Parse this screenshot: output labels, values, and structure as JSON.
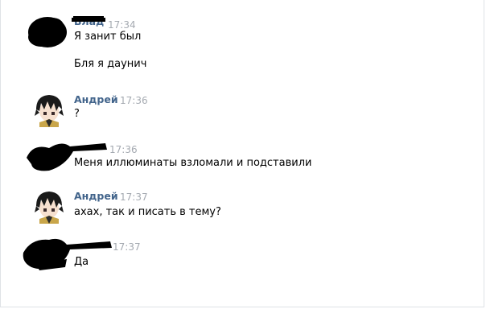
{
  "messages": [
    {
      "author": "Влад",
      "time": "17:34",
      "lines": [
        "Я занит был",
        "Бля я даунич"
      ],
      "censored": true
    },
    {
      "author": "Андрей",
      "time": "17:36",
      "lines": [
        "?"
      ],
      "censored": false
    },
    {
      "author": "",
      "time": "17:36",
      "lines": [
        "Меня иллюминаты взломали и подставили"
      ],
      "censored": true
    },
    {
      "author": "Андрей",
      "time": "17:37",
      "lines": [
        "ахах, так и писать в тему?"
      ],
      "censored": false
    },
    {
      "author": "",
      "time": "17:37",
      "lines": [
        "Да"
      ],
      "censored": true
    }
  ],
  "colors": {
    "author_link": "#42648b",
    "timestamp": "#a5aab1",
    "scribble": "#000000"
  },
  "icons": {
    "avatar_andrey": "anime-avatar-icon"
  }
}
